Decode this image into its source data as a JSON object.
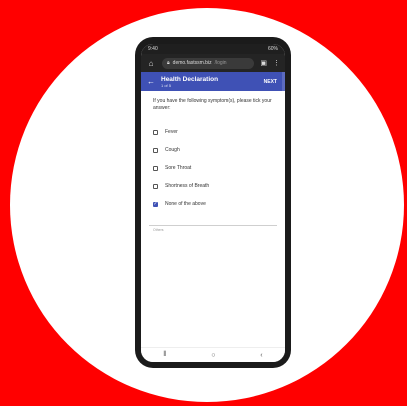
{
  "status": {
    "time": "9:40",
    "battery": "60%"
  },
  "browser": {
    "domain": "demo.fastssm.biz",
    "path": "/login"
  },
  "appbar": {
    "title": "Health Declaration",
    "subtitle": "1 of 5",
    "next_label": "NEXT"
  },
  "question": "If you have the following symptom(s), please tick your answer:",
  "options": [
    {
      "label": "Fever",
      "checked": false
    },
    {
      "label": "Cough",
      "checked": false
    },
    {
      "label": "Sore Throat",
      "checked": false
    },
    {
      "label": "Shortness of Breath",
      "checked": false
    },
    {
      "label": "None of the above",
      "checked": true
    }
  ],
  "others_label": "Others",
  "colors": {
    "background": "#ff0000",
    "appbar": "#3f51b5",
    "checked": "#3f51b5"
  },
  "icons": {
    "back": "arrow-back-icon",
    "home": "home-icon",
    "lock": "lock-icon",
    "tabs": "tabs-icon",
    "menu": "more-vert-icon",
    "nav_recent": "recent-apps-icon",
    "nav_home": "nav-home-icon",
    "nav_back": "nav-back-icon"
  }
}
